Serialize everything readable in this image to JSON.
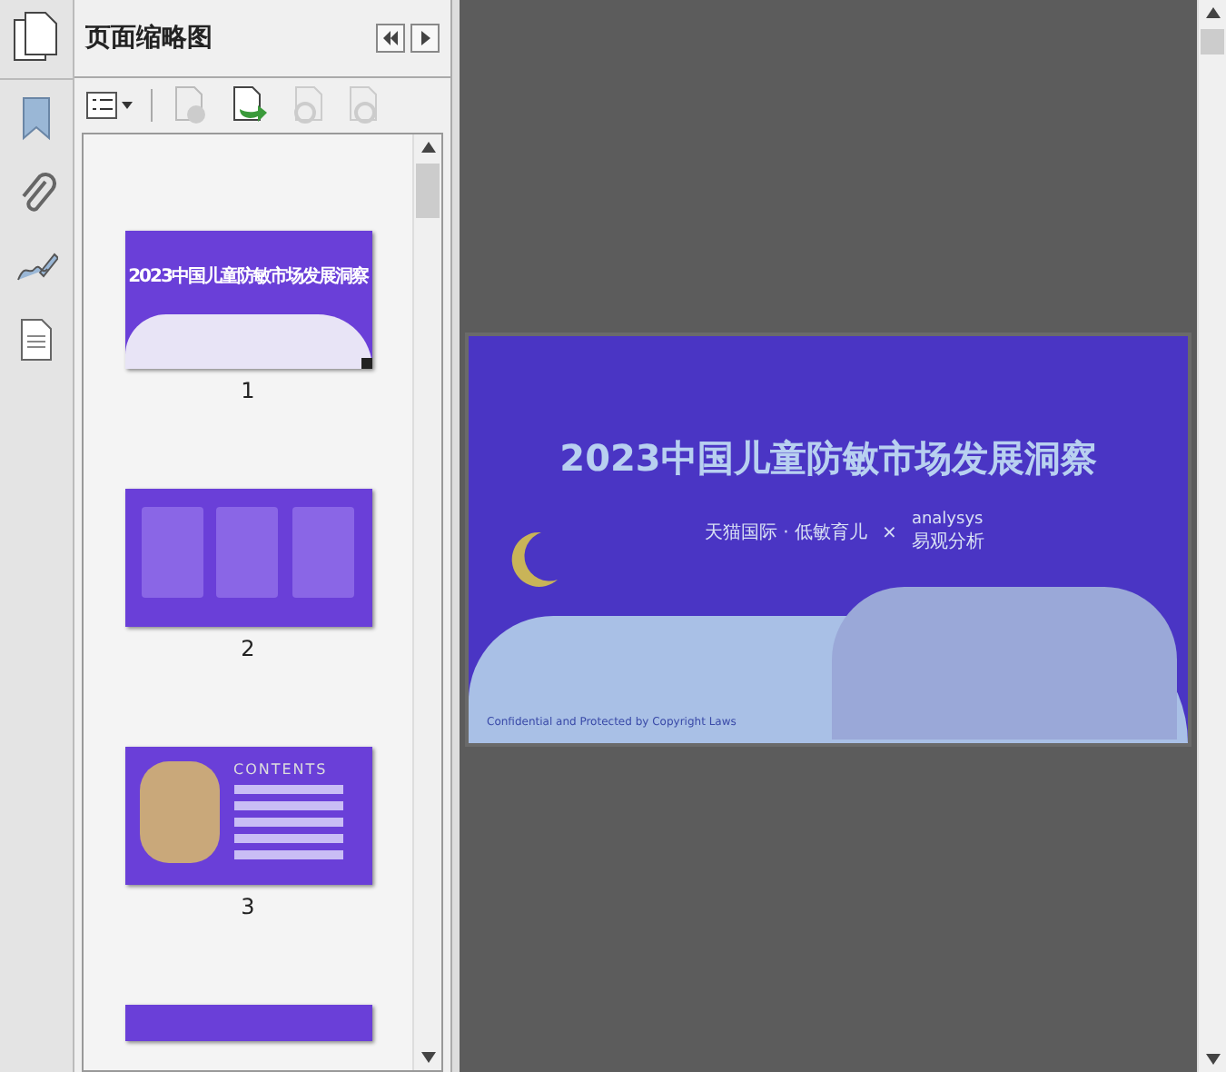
{
  "panel": {
    "title": "页面缩略图"
  },
  "thumbnails": [
    {
      "kind": "cover",
      "label": "1",
      "title": "2023中国儿童防敏市场发展洞察",
      "current": true
    },
    {
      "kind": "columns",
      "label": "2",
      "current": false
    },
    {
      "kind": "contents",
      "label": "3",
      "title": "CONTENTS",
      "current": false
    },
    {
      "kind": "partial",
      "current": false
    }
  ],
  "page": {
    "title": "2023中国儿童防敏市场发展洞察",
    "partners": "天猫国际 · 低敏育儿",
    "cross": "×",
    "logo_top": "analysys",
    "logo_bottom": "易观分析",
    "footer": "Confidential and Protected by Copyright Laws"
  }
}
